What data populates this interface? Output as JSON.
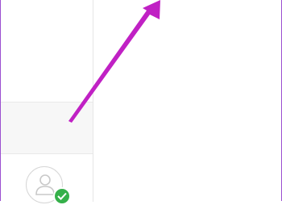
{
  "app": {
    "accent_color": "#9b4fd0",
    "annotation_color": "#c021c4"
  },
  "sidebar": {
    "selected_row": {},
    "account": {
      "avatar_icon": "user-avatar-icon",
      "status_icon": "check-badge-icon",
      "status_color": "#35b04a"
    }
  },
  "annotation": {
    "type": "arrow"
  }
}
